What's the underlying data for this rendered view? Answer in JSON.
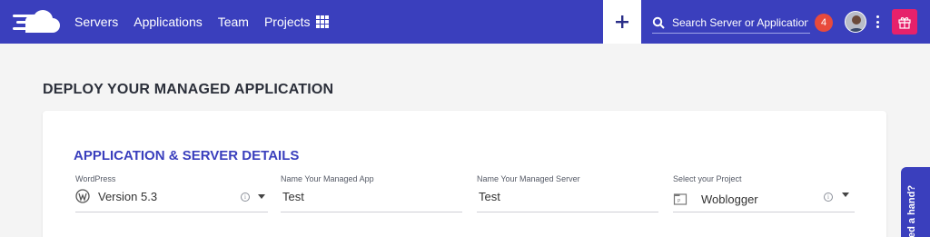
{
  "nav": {
    "items": [
      "Servers",
      "Applications",
      "Team",
      "Projects"
    ]
  },
  "search": {
    "placeholder": "Search Server or Application"
  },
  "notifications": {
    "count": "4"
  },
  "page": {
    "title": "DEPLOY YOUR MANAGED APPLICATION"
  },
  "form": {
    "section_title": "APPLICATION & SERVER DETAILS",
    "app": {
      "label": "WordPress",
      "value": "Version 5.3"
    },
    "app_name": {
      "label": "Name Your Managed App",
      "value": "Test"
    },
    "server_name": {
      "label": "Name Your Managed Server",
      "value": "Test"
    },
    "project": {
      "label": "Select your Project",
      "value": "Woblogger"
    }
  },
  "help": {
    "label": "ed a hand?"
  },
  "colors": {
    "brand": "#3a3fbd",
    "notification": "#e84a3c",
    "gift": "#e6216b"
  },
  "icons": [
    "cloud-logo-icon",
    "apps-grid-icon",
    "plus-icon",
    "search-icon",
    "avatar",
    "kebab-menu-icon",
    "gift-icon",
    "wordpress-icon",
    "info-icon",
    "caret-down-icon",
    "project-icon"
  ]
}
